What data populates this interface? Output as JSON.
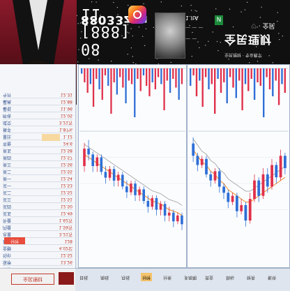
{
  "banner": {
    "ig_handle": "88033zyu",
    "ig_number": "08 [888] 11",
    "card_line1": "1.ItA",
    "card_line2": "— — —",
    "card_line3": "— —",
    "card_badge": "N",
    "brand_big": "全民理财",
    "brand_small": "全民理财 · 专业教学",
    "brand_tag": "♡ · 全民"
  },
  "left_panel": {
    "rows": [
      {
        "label": "今开",
        "value": "12.31"
      },
      {
        "label": "最高",
        "value": "12.88"
      },
      {
        "label": "最低",
        "value": "11.96"
      },
      {
        "label": "昨收",
        "value": "12.05"
      },
      {
        "label": "成交",
        "value": "3.21万"
      },
      {
        "label": "换手",
        "value": "1.87%"
      },
      {
        "label": "量比",
        "value": "1.12"
      },
      {
        "label": "市盈",
        "value": "24.6"
      },
      {
        "label": "卖五",
        "value": "12.58"
      },
      {
        "label": "卖四",
        "value": "12.57"
      },
      {
        "label": "卖三",
        "value": "12.56"
      },
      {
        "label": "卖二",
        "value": "12.55"
      },
      {
        "label": "卖一",
        "value": "12.54"
      },
      {
        "label": "买一",
        "value": "12.53"
      },
      {
        "label": "买二",
        "value": "12.52"
      },
      {
        "label": "买三",
        "value": "12.51"
      },
      {
        "label": "买四",
        "value": "12.50"
      },
      {
        "label": "买五",
        "value": "12.49"
      },
      {
        "label": "外盘",
        "value": "1.62万"
      },
      {
        "label": "内盘",
        "value": "1.59万"
      },
      {
        "label": "总量",
        "value": "3.21万"
      },
      {
        "label": "现量",
        "value": "128"
      },
      {
        "label": "金额",
        "value": "4.02亿"
      },
      {
        "label": "均价",
        "value": "12.52"
      },
      {
        "label": "涨停",
        "value": "13.26"
      },
      {
        "label": "跌停",
        "value": "10.85"
      }
    ],
    "badge": "分时",
    "footer_pill": "全民理财"
  },
  "bottom_bar": {
    "tabs": [
      "日线",
      "周线",
      "月线",
      "分时",
      "分类",
      "多周期",
      "资金",
      "指标",
      "财务",
      "板块"
    ],
    "active_index": 3
  },
  "colors": {
    "up": "#e0314b",
    "down": "#2f6fd6",
    "ma_orange": "#f08a24",
    "ma_gray": "#9a9a9a"
  },
  "chart_data": [
    {
      "type": "bar",
      "name": "left-volume",
      "values": [
        3,
        8,
        14,
        9,
        22,
        6,
        12,
        18,
        4,
        10,
        26,
        8,
        15,
        5,
        11,
        20,
        7,
        9,
        28,
        6,
        13,
        4,
        10,
        16,
        8,
        12,
        5,
        9,
        24,
        7,
        14,
        6,
        11,
        18,
        9
      ]
    },
    {
      "type": "candlestick",
      "name": "left-price",
      "candles": [
        {
          "o": 11.2,
          "c": 11.8,
          "h": 12.0,
          "l": 11.0
        },
        {
          "o": 11.8,
          "c": 11.6,
          "h": 12.1,
          "l": 11.4
        },
        {
          "o": 11.6,
          "c": 11.2,
          "h": 11.7,
          "l": 11.0
        },
        {
          "o": 11.2,
          "c": 11.5,
          "h": 11.6,
          "l": 11.0
        },
        {
          "o": 11.5,
          "c": 11.0,
          "h": 11.6,
          "l": 10.9
        },
        {
          "o": 11.0,
          "c": 10.8,
          "h": 11.2,
          "l": 10.6
        },
        {
          "o": 10.8,
          "c": 11.1,
          "h": 11.2,
          "l": 10.7
        },
        {
          "o": 11.1,
          "c": 10.7,
          "h": 11.2,
          "l": 10.5
        },
        {
          "o": 10.7,
          "c": 10.9,
          "h": 11.0,
          "l": 10.5
        },
        {
          "o": 10.9,
          "c": 10.5,
          "h": 11.0,
          "l": 10.4
        },
        {
          "o": 10.5,
          "c": 10.3,
          "h": 10.7,
          "l": 10.1
        },
        {
          "o": 10.3,
          "c": 10.6,
          "h": 10.7,
          "l": 10.2
        },
        {
          "o": 10.6,
          "c": 10.2,
          "h": 10.7,
          "l": 10.0
        },
        {
          "o": 10.2,
          "c": 10.4,
          "h": 10.5,
          "l": 10.0
        },
        {
          "o": 10.4,
          "c": 10.0,
          "h": 10.5,
          "l": 9.9
        },
        {
          "o": 10.0,
          "c": 9.8,
          "h": 10.2,
          "l": 9.6
        },
        {
          "o": 9.8,
          "c": 10.1,
          "h": 10.2,
          "l": 9.7
        },
        {
          "o": 10.1,
          "c": 9.7,
          "h": 10.2,
          "l": 9.5
        },
        {
          "o": 9.7,
          "c": 9.9,
          "h": 10.0,
          "l": 9.5
        },
        {
          "o": 9.9,
          "c": 9.5,
          "h": 10.0,
          "l": 9.3
        },
        {
          "o": 9.5,
          "c": 9.6,
          "h": 9.8,
          "l": 9.3
        },
        {
          "o": 9.6,
          "c": 9.3,
          "h": 9.7,
          "l": 9.1
        },
        {
          "o": 9.3,
          "c": 9.5,
          "h": 9.6,
          "l": 9.2
        },
        {
          "o": 9.5,
          "c": 9.2,
          "h": 9.6,
          "l": 9.0
        }
      ],
      "ma": [
        11.6,
        11.5,
        11.4,
        11.3,
        11.2,
        11.1,
        11.0,
        10.9,
        10.8,
        10.7,
        10.6,
        10.5,
        10.4,
        10.3,
        10.2,
        10.1,
        10.0,
        9.95,
        9.9,
        9.8,
        9.7,
        9.65,
        9.6,
        9.5
      ],
      "ylim": [
        8.8,
        12.4
      ]
    },
    {
      "type": "bar",
      "name": "right-volume",
      "values": [
        10,
        4,
        16,
        7,
        22,
        5,
        12,
        9,
        26,
        6,
        14,
        8,
        20,
        5,
        11,
        17,
        7,
        24,
        9,
        13,
        6,
        18,
        8,
        10,
        28,
        5,
        12,
        16,
        7,
        21,
        9,
        14
      ]
    },
    {
      "type": "candlestick",
      "name": "right-price",
      "candles": [
        {
          "o": 12.6,
          "c": 12.2,
          "h": 12.8,
          "l": 12.0
        },
        {
          "o": 12.2,
          "c": 11.9,
          "h": 12.3,
          "l": 11.7
        },
        {
          "o": 11.9,
          "c": 12.1,
          "h": 12.2,
          "l": 11.8
        },
        {
          "o": 12.1,
          "c": 11.6,
          "h": 12.2,
          "l": 11.5
        },
        {
          "o": 11.6,
          "c": 11.4,
          "h": 11.7,
          "l": 11.2
        },
        {
          "o": 11.4,
          "c": 11.7,
          "h": 11.8,
          "l": 11.3
        },
        {
          "o": 11.7,
          "c": 11.2,
          "h": 11.8,
          "l": 11.0
        },
        {
          "o": 11.2,
          "c": 11.0,
          "h": 11.3,
          "l": 10.8
        },
        {
          "o": 11.0,
          "c": 10.7,
          "h": 11.1,
          "l": 10.5
        },
        {
          "o": 10.7,
          "c": 10.9,
          "h": 11.0,
          "l": 10.6
        },
        {
          "o": 10.9,
          "c": 10.4,
          "h": 11.0,
          "l": 10.2
        },
        {
          "o": 10.4,
          "c": 10.6,
          "h": 10.8,
          "l": 10.3
        },
        {
          "o": 10.6,
          "c": 10.1,
          "h": 10.7,
          "l": 9.9
        },
        {
          "o": 10.1,
          "c": 10.8,
          "h": 11.0,
          "l": 10.0
        },
        {
          "o": 10.8,
          "c": 11.4,
          "h": 11.6,
          "l": 10.7
        },
        {
          "o": 11.4,
          "c": 10.9,
          "h": 11.5,
          "l": 10.7
        },
        {
          "o": 10.9,
          "c": 11.6,
          "h": 11.8,
          "l": 10.8
        },
        {
          "o": 11.6,
          "c": 11.2,
          "h": 11.8,
          "l": 11.0
        },
        {
          "o": 11.2,
          "c": 11.9,
          "h": 12.1,
          "l": 11.1
        },
        {
          "o": 11.9,
          "c": 11.5,
          "h": 12.0,
          "l": 11.3
        },
        {
          "o": 11.5,
          "c": 12.2,
          "h": 12.4,
          "l": 11.4
        },
        {
          "o": 12.2,
          "c": 11.8,
          "h": 12.3,
          "l": 11.6
        }
      ],
      "ma": [
        12.4,
        12.2,
        12.0,
        11.9,
        11.7,
        11.6,
        11.4,
        11.3,
        11.1,
        11.0,
        10.9,
        10.8,
        10.7,
        10.7,
        10.8,
        10.9,
        11.0,
        11.1,
        11.2,
        11.3,
        11.4,
        11.5
      ],
      "ylim": [
        9.6,
        13.0
      ]
    }
  ]
}
